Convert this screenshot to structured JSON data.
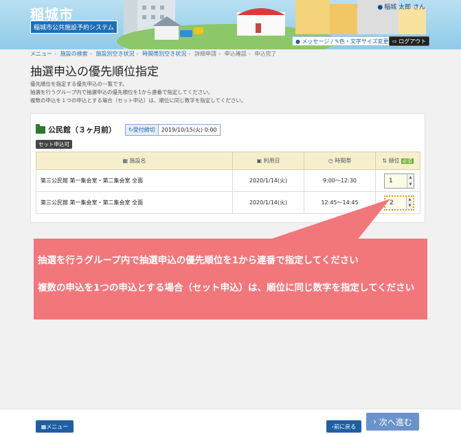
{
  "header": {
    "city": "稲城市",
    "system_name": "稲城市公共施設予約システム",
    "user": "稲城 太郎 さん",
    "message_button": "メッセージ",
    "text_size_button": "色・文字サイズ変更",
    "logout_button": "ログアウト"
  },
  "breadcrumb": [
    "メニュー",
    "施設の検索",
    "施設別空き状況",
    "時間帯別空き状況",
    "詳細申請",
    "申込確認",
    "申込完了"
  ],
  "page": {
    "title": "抽選申込の優先順位指定",
    "desc1": "優先順位を指定する優先申込の一覧です。",
    "desc2": "抽選を行うグループ内で抽選申込の優先順位を1から連番で指定してください。",
    "desc3": "複数の申込を１つの申込とする場合（セット申込）は、順位に同じ数字を指定してください。"
  },
  "facility": {
    "title": "公民館（３ヶ月前）",
    "deadline_label": "受付締切",
    "deadline_value": "2019/10/15(火) 0:00",
    "set_badge": "セット申込可"
  },
  "table": {
    "headers": {
      "name": "施設名",
      "date": "利用日",
      "time": "時間帯",
      "rank": "順位",
      "required": "必須"
    },
    "rows": [
      {
        "name": "第三公民館 第一集会室・第二集会室 全面",
        "date": "2020/1/14(火)",
        "time": "9:00～12:30",
        "rank": "1"
      },
      {
        "name": "第三公民館 第一集会室・第二集会室 全面",
        "date": "2020/1/14(火)",
        "time": "12:45～14:45",
        "rank": "2"
      }
    ]
  },
  "callout": {
    "line1": "抽選を行うグループ内で抽選申込の優先順位を1から連番で指定してください",
    "line2": "複数の申込を1つの申込とする場合（セット申込）は、順位に同じ数字を指定してください"
  },
  "footer": {
    "menu": "メニュー",
    "back": "前に戻る",
    "next": "次へ進む"
  },
  "colors": {
    "accent": "#1e5fa3",
    "callout": "#f2777b",
    "header_bg": "#a9d6ee"
  }
}
